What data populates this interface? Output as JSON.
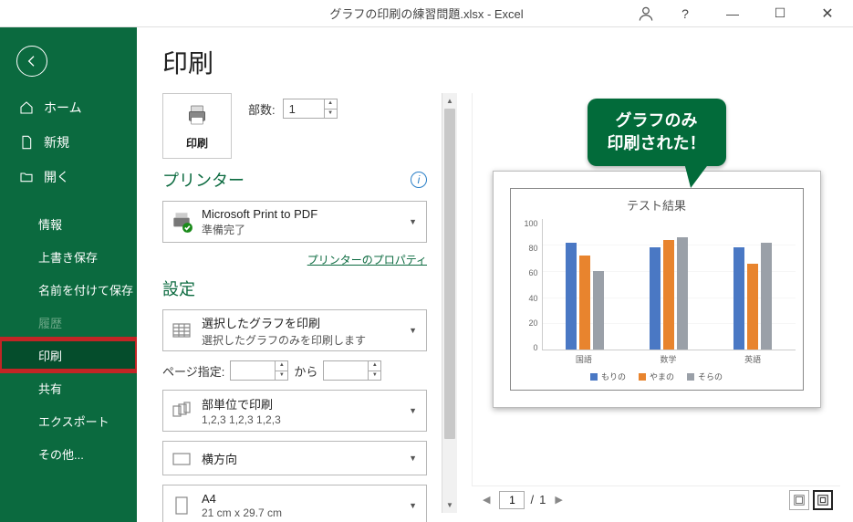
{
  "titlebar": {
    "title": "グラフの印刷の練習問題.xlsx - Excel"
  },
  "sidebar": {
    "home": "ホーム",
    "new": "新規",
    "open": "開く",
    "info": "情報",
    "save": "上書き保存",
    "saveas": "名前を付けて保存",
    "history": "履歴",
    "print": "印刷",
    "share": "共有",
    "export": "エクスポート",
    "other": "その他..."
  },
  "main": {
    "title": "印刷",
    "print_button": "印刷",
    "copies_label": "部数:",
    "copies_value": "1",
    "printer_section": "プリンター",
    "printer_name": "Microsoft Print to PDF",
    "printer_status": "準備完了",
    "printer_properties": "プリンターのプロパティ",
    "settings_section": "設定",
    "print_what_line1": "選択したグラフを印刷",
    "print_what_line2": "選択したグラフのみを印刷します",
    "page_range_label": "ページ指定:",
    "page_range_from": "",
    "page_range_to_label": "から",
    "page_range_to": "",
    "collate_line1": "部単位で印刷",
    "collate_line2": "1,2,3   1,2,3   1,2,3",
    "orientation": "横方向",
    "paper_line1": "A4",
    "paper_line2": "21 cm x 29.7 cm"
  },
  "preview": {
    "callout_line1": "グラフのみ",
    "callout_line2": "印刷された！",
    "page_current": "1",
    "page_sep": "/",
    "page_total": "1"
  },
  "chart_data": {
    "type": "bar",
    "title": "テスト結果",
    "categories": [
      "国語",
      "数学",
      "英語"
    ],
    "series": [
      {
        "name": "もりの",
        "values": [
          82,
          78,
          78
        ],
        "color": "#4a78c4"
      },
      {
        "name": "やまの",
        "values": [
          72,
          84,
          66
        ],
        "color": "#e8842e"
      },
      {
        "name": "そらの",
        "values": [
          60,
          86,
          82
        ],
        "color": "#9aa0a8"
      }
    ],
    "ylim": [
      0,
      100
    ],
    "yticks": [
      0,
      20,
      40,
      60,
      80,
      100
    ]
  }
}
